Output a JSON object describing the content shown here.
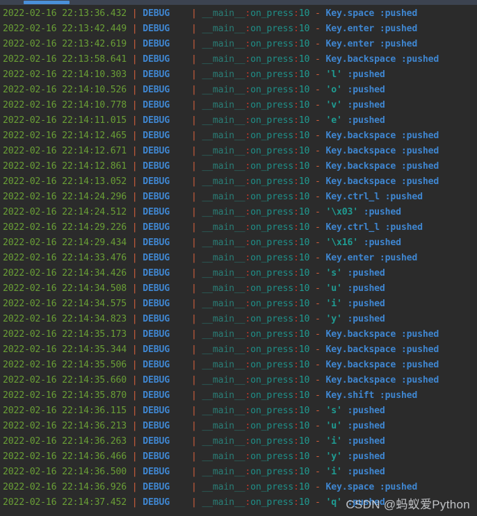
{
  "window": {
    "background_color": "#2b2b2b",
    "scrollbar": {
      "track_color": "#3c4350",
      "thumb_color": "#4a90d9",
      "orientation": "horizontal",
      "position": "top"
    }
  },
  "colors": {
    "timestamp": "#6a9f36",
    "pipe_separator": "#d4603c",
    "level": "#3f86d0",
    "module": "#2a7d76",
    "function": "#1f8f88",
    "line_number": "#1f9c92",
    "dash": "#d4603c",
    "key_name": "#3f86d0",
    "char_literal": "#1f9c92",
    "pushed": "#3f86d0"
  },
  "log": {
    "level_label": "DEBUG",
    "module_label": "__main__",
    "function_label": "on_press",
    "line_number_label": "10",
    "separator": "|",
    "dash": "-",
    "status_label": ":pushed",
    "rows": [
      {
        "timestamp": "2022-02-16 22:13:36.432",
        "target": "Key.space",
        "target_kind": "key"
      },
      {
        "timestamp": "2022-02-16 22:13:42.449",
        "target": "Key.enter",
        "target_kind": "key"
      },
      {
        "timestamp": "2022-02-16 22:13:42.619",
        "target": "Key.enter",
        "target_kind": "key"
      },
      {
        "timestamp": "2022-02-16 22:13:58.641",
        "target": "Key.backspace",
        "target_kind": "key"
      },
      {
        "timestamp": "2022-02-16 22:14:10.303",
        "target": "'l'",
        "target_kind": "char"
      },
      {
        "timestamp": "2022-02-16 22:14:10.526",
        "target": "'o'",
        "target_kind": "char"
      },
      {
        "timestamp": "2022-02-16 22:14:10.778",
        "target": "'v'",
        "target_kind": "char"
      },
      {
        "timestamp": "2022-02-16 22:14:11.015",
        "target": "'e'",
        "target_kind": "char"
      },
      {
        "timestamp": "2022-02-16 22:14:12.465",
        "target": "Key.backspace",
        "target_kind": "key"
      },
      {
        "timestamp": "2022-02-16 22:14:12.671",
        "target": "Key.backspace",
        "target_kind": "key"
      },
      {
        "timestamp": "2022-02-16 22:14:12.861",
        "target": "Key.backspace",
        "target_kind": "key"
      },
      {
        "timestamp": "2022-02-16 22:14:13.052",
        "target": "Key.backspace",
        "target_kind": "key"
      },
      {
        "timestamp": "2022-02-16 22:14:24.296",
        "target": "Key.ctrl_l",
        "target_kind": "key"
      },
      {
        "timestamp": "2022-02-16 22:14:24.512",
        "target": "'\\x03'",
        "target_kind": "char"
      },
      {
        "timestamp": "2022-02-16 22:14:29.226",
        "target": "Key.ctrl_l",
        "target_kind": "key"
      },
      {
        "timestamp": "2022-02-16 22:14:29.434",
        "target": "'\\x16'",
        "target_kind": "char"
      },
      {
        "timestamp": "2022-02-16 22:14:33.476",
        "target": "Key.enter",
        "target_kind": "key"
      },
      {
        "timestamp": "2022-02-16 22:14:34.426",
        "target": "'s'",
        "target_kind": "char"
      },
      {
        "timestamp": "2022-02-16 22:14:34.508",
        "target": "'u'",
        "target_kind": "char"
      },
      {
        "timestamp": "2022-02-16 22:14:34.575",
        "target": "'i'",
        "target_kind": "char"
      },
      {
        "timestamp": "2022-02-16 22:14:34.823",
        "target": "'y'",
        "target_kind": "char"
      },
      {
        "timestamp": "2022-02-16 22:14:35.173",
        "target": "Key.backspace",
        "target_kind": "key"
      },
      {
        "timestamp": "2022-02-16 22:14:35.344",
        "target": "Key.backspace",
        "target_kind": "key"
      },
      {
        "timestamp": "2022-02-16 22:14:35.506",
        "target": "Key.backspace",
        "target_kind": "key"
      },
      {
        "timestamp": "2022-02-16 22:14:35.660",
        "target": "Key.backspace",
        "target_kind": "key"
      },
      {
        "timestamp": "2022-02-16 22:14:35.870",
        "target": "Key.shift",
        "target_kind": "key"
      },
      {
        "timestamp": "2022-02-16 22:14:36.115",
        "target": "'s'",
        "target_kind": "char"
      },
      {
        "timestamp": "2022-02-16 22:14:36.213",
        "target": "'u'",
        "target_kind": "char"
      },
      {
        "timestamp": "2022-02-16 22:14:36.263",
        "target": "'i'",
        "target_kind": "char"
      },
      {
        "timestamp": "2022-02-16 22:14:36.466",
        "target": "'y'",
        "target_kind": "char"
      },
      {
        "timestamp": "2022-02-16 22:14:36.500",
        "target": "'i'",
        "target_kind": "char"
      },
      {
        "timestamp": "2022-02-16 22:14:36.926",
        "target": "Key.space",
        "target_kind": "key"
      },
      {
        "timestamp": "2022-02-16 22:14:37.452",
        "target": "'q'",
        "target_kind": "char"
      }
    ]
  },
  "watermark": {
    "text": "CSDN @蚂蚁爱Python"
  }
}
